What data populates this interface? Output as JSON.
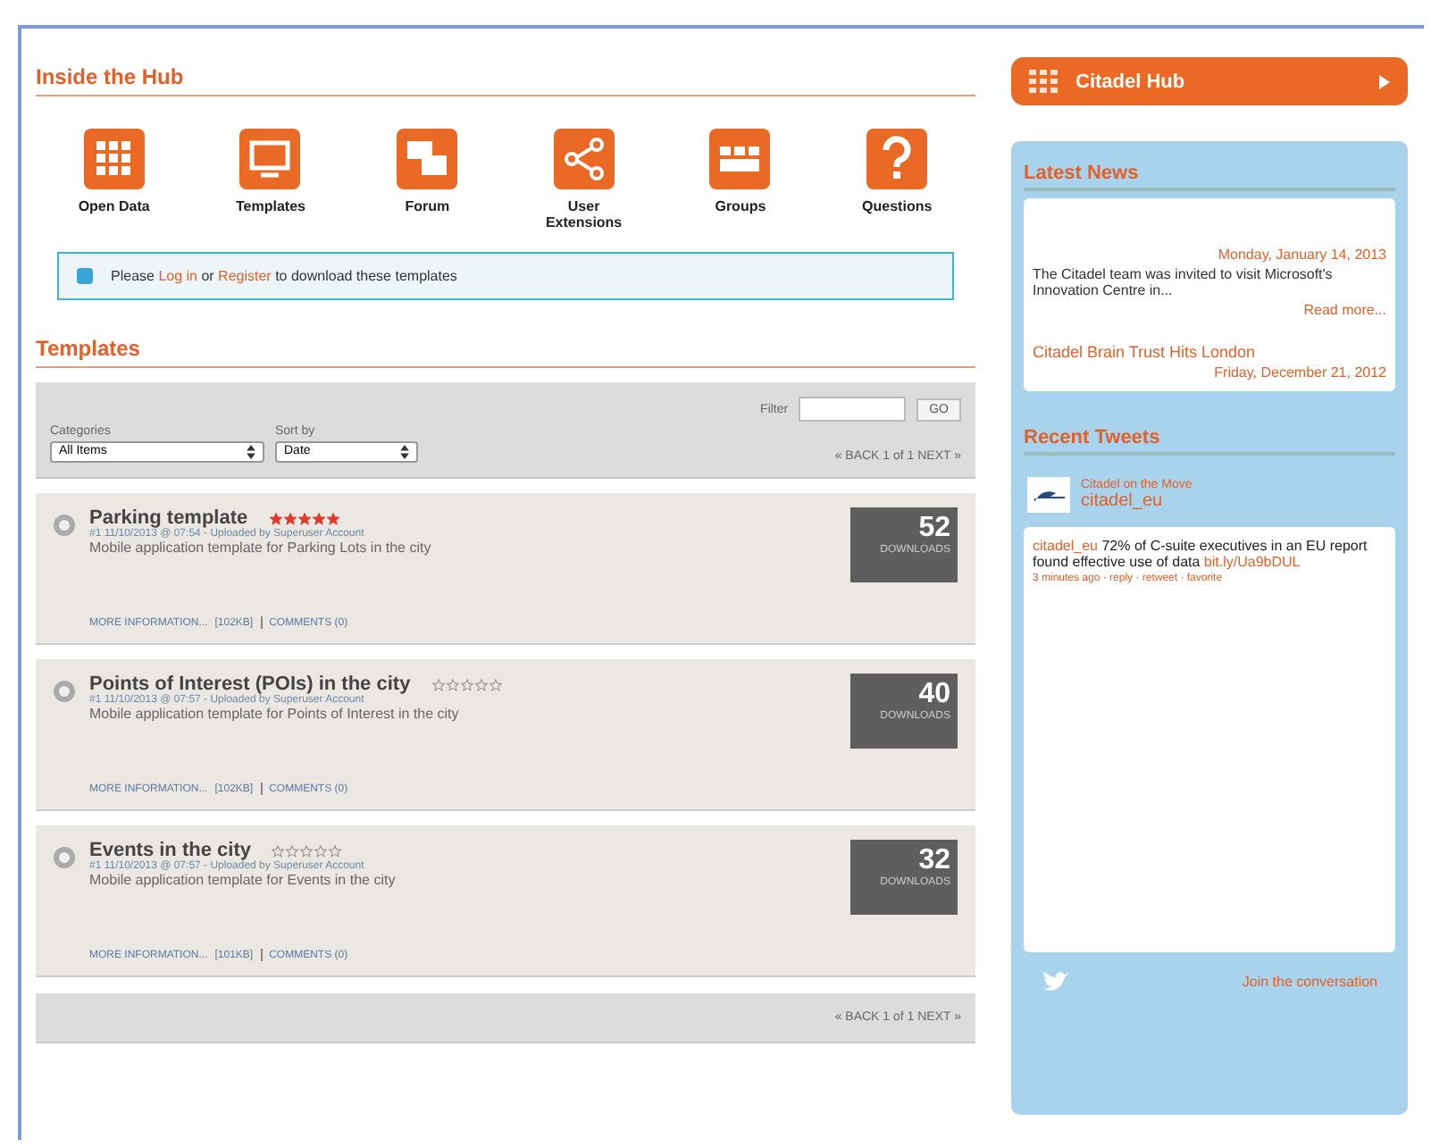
{
  "hub": {
    "title": "Inside the Hub",
    "items": [
      {
        "kind": "grid",
        "label": "Open Data"
      },
      {
        "kind": "monitor",
        "label": "Templates"
      },
      {
        "kind": "chat",
        "label": "Forum"
      },
      {
        "kind": "share",
        "label": "User Extensions"
      },
      {
        "kind": "people",
        "label": "Groups"
      },
      {
        "kind": "question",
        "label": "Questions"
      }
    ]
  },
  "notice": {
    "before": "Please",
    "login": "Log in",
    "middle": "or",
    "register": "Register",
    "after": "to download these templates"
  },
  "templates": {
    "title": "Templates",
    "filter": {
      "label": "Filter",
      "button": "GO"
    },
    "categories": {
      "label": "Categories",
      "value": "All Items"
    },
    "sort": {
      "label": "Sort by",
      "value": "Date"
    },
    "pager_top": "« BACK 1 of 1 NEXT »",
    "items": [
      {
        "title": "Parking template",
        "stars": 5,
        "meta": "#1 11/10/2013 @ 07:54 - Uploaded by Superuser Account",
        "description": "Mobile application template for Parking Lots in the city",
        "more": "MORE INFORMATION...",
        "size": "[102KB]",
        "comments": "COMMENTS (0)",
        "count": "52",
        "count_label": "DOWNLOADS"
      },
      {
        "title": "Points of Interest (POIs) in the city",
        "stars": 0,
        "meta": "#1 11/10/2013 @ 07:57 - Uploaded by Superuser Account",
        "description": "Mobile application template for Points of Interest in the city",
        "more": "MORE INFORMATION...",
        "size": "[102KB]",
        "comments": "COMMENTS (0)",
        "count": "40",
        "count_label": "DOWNLOADS"
      },
      {
        "title": "Events in the city",
        "stars": 0,
        "meta": "#1 11/10/2013 @ 07:57 - Uploaded by Superuser Account",
        "description": "Mobile application template for Events in the city",
        "more": "MORE INFORMATION...",
        "size": "[101KB]",
        "comments": "COMMENTS (0)",
        "count": "32",
        "count_label": "DOWNLOADS"
      }
    ],
    "pager_bottom": "« BACK 1 of 1 NEXT »"
  },
  "hub_button": "Citadel Hub",
  "news": {
    "title": "Latest News",
    "items": [
      {
        "date": "Monday, January 14, 2013",
        "text": "The Citadel team was invited to visit Microsoft's Innovation Centre in...",
        "more": "Read more..."
      },
      {
        "headline": "Citadel Brain Trust Hits London",
        "date": "Friday, December 21, 2012"
      }
    ]
  },
  "tweets": {
    "title": "Recent Tweets",
    "account_name": "Citadel on the Move",
    "handle": "citadel_eu",
    "tweet": {
      "user": "citadel_eu",
      "text": "72% of C-suite executives in an EU report found effective use of data",
      "link": "bit.ly/Ua9bDUL",
      "meta": "3 minutes ago · reply · retweet · favorite"
    },
    "join": "Join the conversation"
  }
}
